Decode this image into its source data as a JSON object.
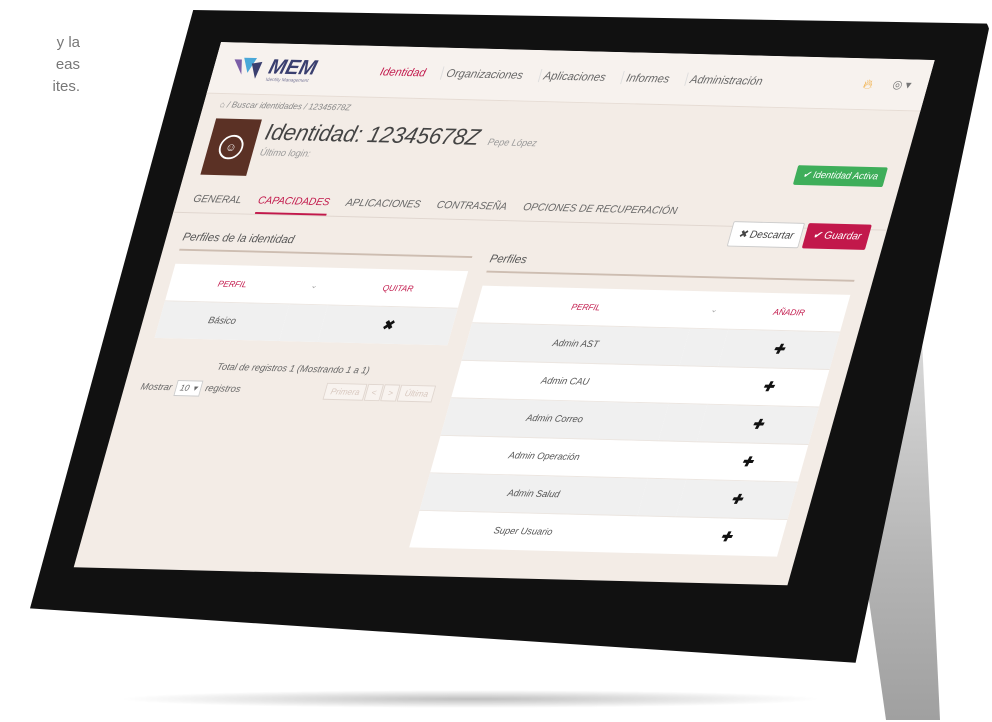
{
  "background_text": [
    "y la",
    "eas",
    "ites."
  ],
  "app": {
    "logo_text": "MEM",
    "logo_sub": "Identity Management"
  },
  "nav": {
    "items": [
      {
        "label": "Identidad",
        "active": true
      },
      {
        "label": "Organizaciones",
        "active": false
      },
      {
        "label": "Aplicaciones",
        "active": false
      },
      {
        "label": "Informes",
        "active": false
      },
      {
        "label": "Administración",
        "active": false
      }
    ],
    "flame_icon": "flame-icon",
    "user_icon": "user-icon"
  },
  "breadcrumb": {
    "home_icon": "home-icon",
    "items": [
      "Buscar identidades",
      "12345678Z"
    ]
  },
  "identity": {
    "title": "Identidad: 12345678Z",
    "name": "Pepe López",
    "last_login_label": "Último login:"
  },
  "status_badge": "Identidad Activa",
  "tabs": [
    {
      "label": "GENERAL",
      "active": false
    },
    {
      "label": "CAPACIDADES",
      "active": true
    },
    {
      "label": "APLICACIONES",
      "active": false
    },
    {
      "label": "CONTRASEÑA",
      "active": false
    },
    {
      "label": "OPCIONES DE RECUPERACIÓN",
      "active": false
    }
  ],
  "actions": {
    "discard": "Descartar",
    "save": "Guardar"
  },
  "left_panel": {
    "title": "Perfiles de la identidad",
    "columns": {
      "profile": "PERFIL",
      "remove": "QUITAR"
    },
    "rows": [
      {
        "profile": "Básico",
        "action_icon": "x-icon"
      }
    ],
    "total": "Total de registros 1 (Mostrando 1 a 1)",
    "show_label": "Mostrar",
    "page_size": "10",
    "records_label": "registros",
    "pager": [
      "Primera",
      "<",
      ">",
      "Última"
    ]
  },
  "right_panel": {
    "title": "Perfiles",
    "columns": {
      "profile": "PERFIL",
      "add": "AÑADIR"
    },
    "rows": [
      {
        "profile": "Admin AST"
      },
      {
        "profile": "Admin CAU"
      },
      {
        "profile": "Admin Correo"
      },
      {
        "profile": "Admin Operación"
      },
      {
        "profile": "Admin Salud"
      },
      {
        "profile": "Super Usuario"
      }
    ]
  },
  "colors": {
    "accent": "#c2184b",
    "active_badge": "#3eae5a",
    "avatar": "#5b3125"
  }
}
